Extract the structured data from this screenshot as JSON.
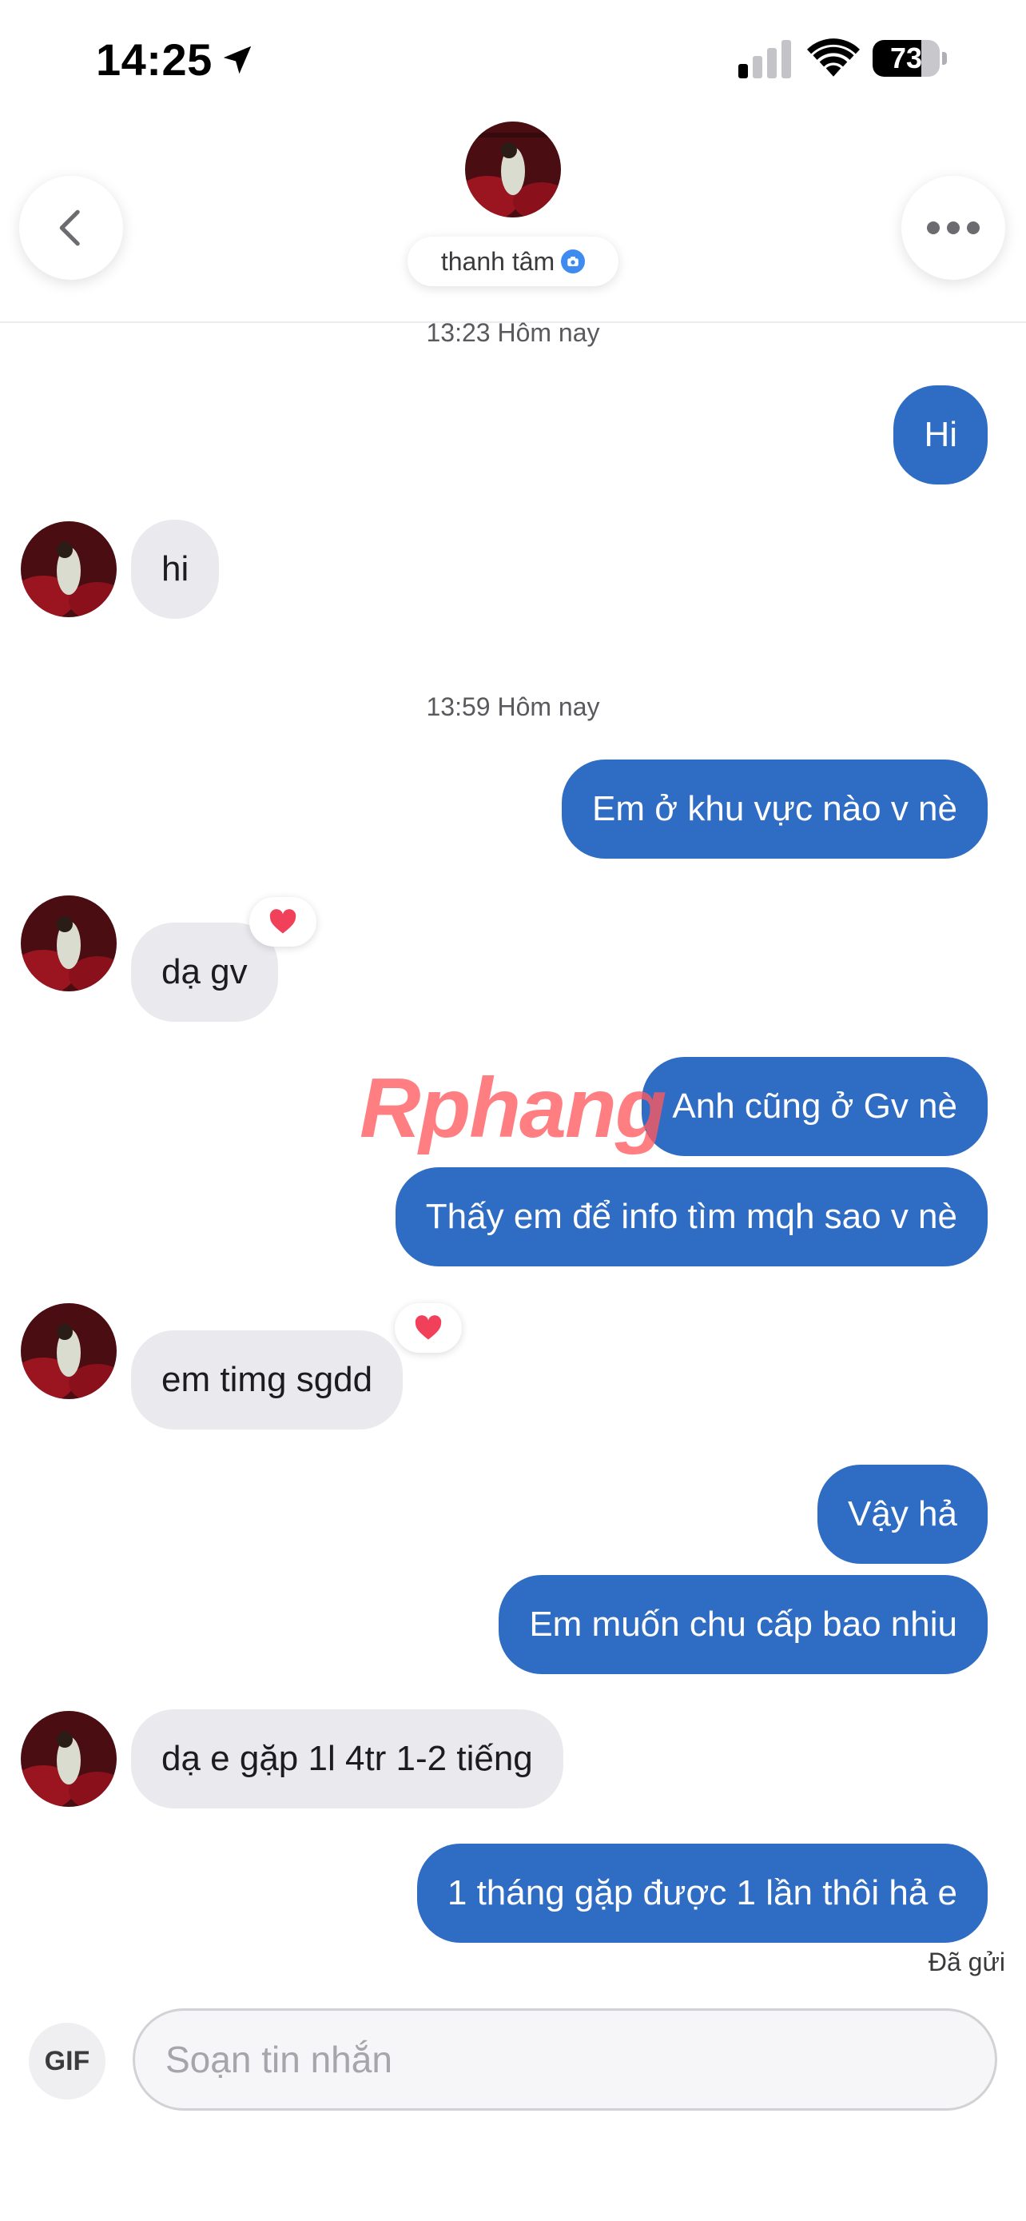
{
  "status_bar": {
    "time": "14:25",
    "battery_level": "73",
    "battery_fraction": 0.73
  },
  "header": {
    "contact_name": "thanh tâm",
    "verified_icon": "camera-icon"
  },
  "messages": [
    {
      "type": "timestamp",
      "text": "13:23 Hôm nay"
    },
    {
      "type": "sent",
      "text": "Hi"
    },
    {
      "type": "received",
      "text": "hi"
    },
    {
      "type": "timestamp",
      "text": "13:59 Hôm nay"
    },
    {
      "type": "sent",
      "text": "Em ở khu vực nào v nè"
    },
    {
      "type": "received",
      "text": "dạ gv",
      "reaction": "heart"
    },
    {
      "type": "sent",
      "text": "Anh cũng ở Gv nè"
    },
    {
      "type": "sent",
      "text": "Thấy em để info tìm mqh sao v nè"
    },
    {
      "type": "received",
      "text": "em timg sgdd",
      "reaction": "heart"
    },
    {
      "type": "sent",
      "text": "Vậy hả"
    },
    {
      "type": "sent",
      "text": "Em muốn chu cấp bao nhiu"
    },
    {
      "type": "received",
      "text": "dạ e gặp 1l 4tr 1-2 tiếng"
    },
    {
      "type": "sent",
      "text": "1 tháng gặp được 1 lần thôi hả e"
    }
  ],
  "sent_status": "Đã gửi",
  "watermark": {
    "part1": "Rphang",
    "part2": ""
  },
  "composer": {
    "gif_label": "GIF",
    "placeholder": "Soạn tin nhắn",
    "value": ""
  },
  "colors": {
    "sent_bubble": "#2f6cc4",
    "received_bubble": "#e9e9ee",
    "reaction_heart": "#f0405a"
  }
}
